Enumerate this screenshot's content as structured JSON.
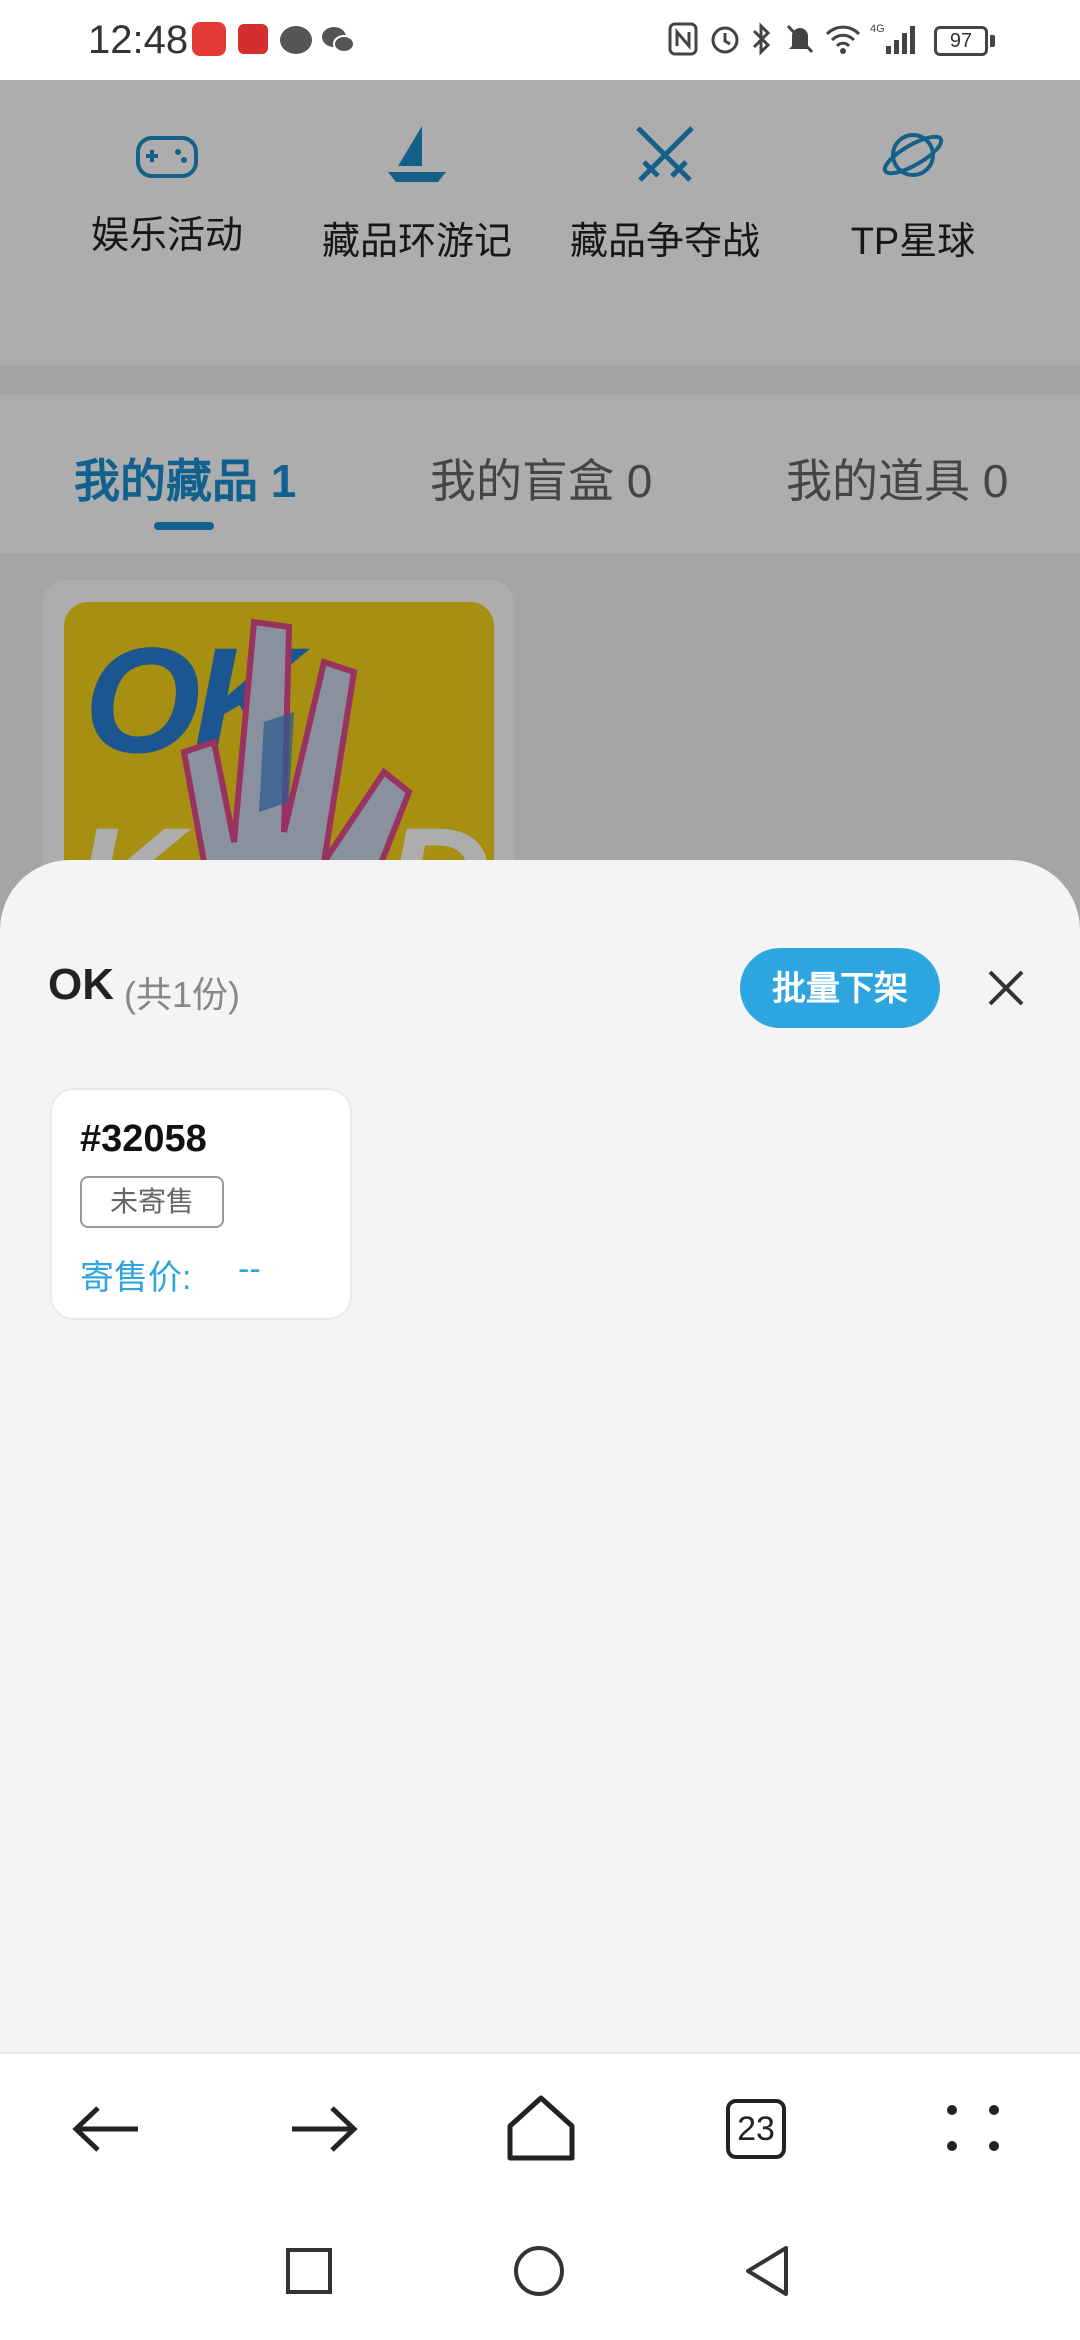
{
  "status_bar": {
    "time": "12:48",
    "battery": "97",
    "icons": [
      "huawei-app-icon",
      "app-icon",
      "message-icon",
      "wechat-icon",
      "nfc-icon",
      "alarm-icon",
      "bluetooth-icon",
      "mute-icon",
      "wifi-icon",
      "signal-4g-icon",
      "battery-icon"
    ]
  },
  "shortcuts": [
    {
      "label": "娱乐活动",
      "icon": "gamepad-icon"
    },
    {
      "label": "藏品环游记",
      "icon": "sailboat-icon"
    },
    {
      "label": "藏品争夺战",
      "icon": "crossed-swords-icon"
    },
    {
      "label": "TP星球",
      "icon": "planet-icon"
    }
  ],
  "tabs": [
    {
      "label": "我的藏品 1",
      "active": true
    },
    {
      "label": "我的盲盒 0",
      "active": false
    },
    {
      "label": "我的道具 0",
      "active": false
    }
  ],
  "sheet": {
    "title": "OK",
    "count": "(共1份)",
    "batch_button": "批量下架",
    "item": {
      "number": "#32058",
      "status": "未寄售",
      "price_label": "寄售价:",
      "price_value": "--"
    }
  },
  "toolbar": {
    "tabs_count": "23",
    "buttons": [
      "back-arrow-icon",
      "forward-arrow-icon",
      "home-icon",
      "tabs-icon",
      "more-icon"
    ]
  },
  "colors": {
    "accent": "#2ea5df",
    "tab_active": "#1a8fd1",
    "sheet_bg": "#f4f4f5"
  }
}
